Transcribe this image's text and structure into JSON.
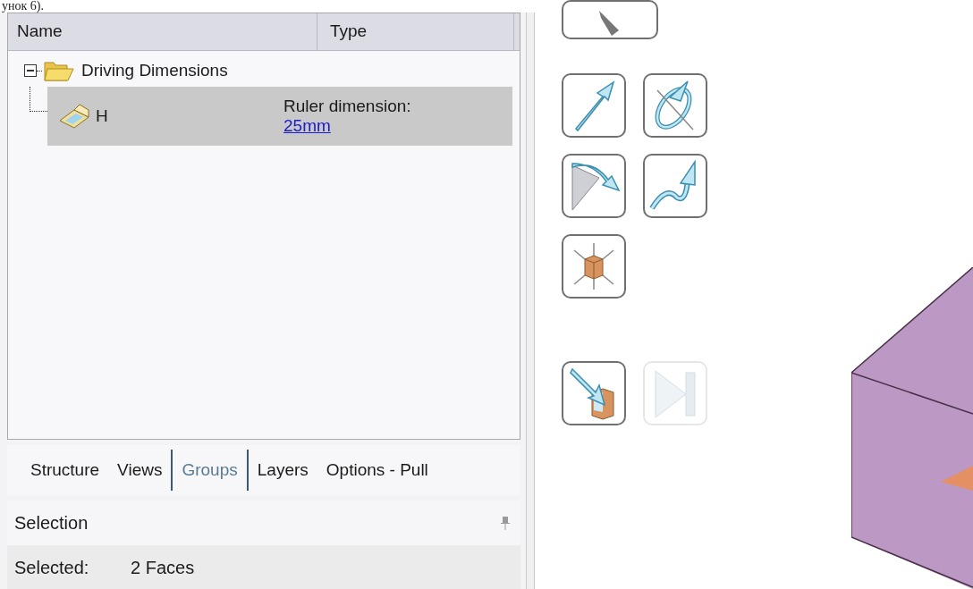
{
  "caption": "унок 6).",
  "tree": {
    "columns": [
      "Name",
      "Type"
    ],
    "items": [
      {
        "name": "Driving Dimensions",
        "kind": "folder",
        "expanded": true,
        "selected": false,
        "children": [
          {
            "name": "H",
            "kind": "dimension",
            "selected": true,
            "type": "Ruler dimension:",
            "value": "25mm"
          }
        ]
      }
    ]
  },
  "tabs": [
    {
      "label": "Structure",
      "selected": false
    },
    {
      "label": "Views",
      "selected": false
    },
    {
      "label": "Groups",
      "selected": true
    },
    {
      "label": "Layers",
      "selected": false
    },
    {
      "label": "Options - Pull",
      "selected": false
    }
  ],
  "selection_panel": {
    "title": "Selection",
    "label": "Selected:",
    "value": "2 Faces"
  },
  "tool_groups": [
    [
      [
        {
          "kind": "cut",
          "disabled": false
        }
      ]
    ],
    [
      [
        {
          "kind": "straight-arrow",
          "disabled": false
        },
        {
          "kind": "orbit-arrow",
          "disabled": false
        }
      ],
      [
        {
          "kind": "corner-arrow",
          "disabled": false
        },
        {
          "kind": "curve-arrow",
          "disabled": false
        }
      ],
      [
        {
          "kind": "cube-arrows",
          "disabled": false
        }
      ]
    ],
    [
      [
        {
          "kind": "arrow-into-cube",
          "disabled": false
        },
        {
          "kind": "play-end",
          "disabled": true
        }
      ]
    ]
  ]
}
